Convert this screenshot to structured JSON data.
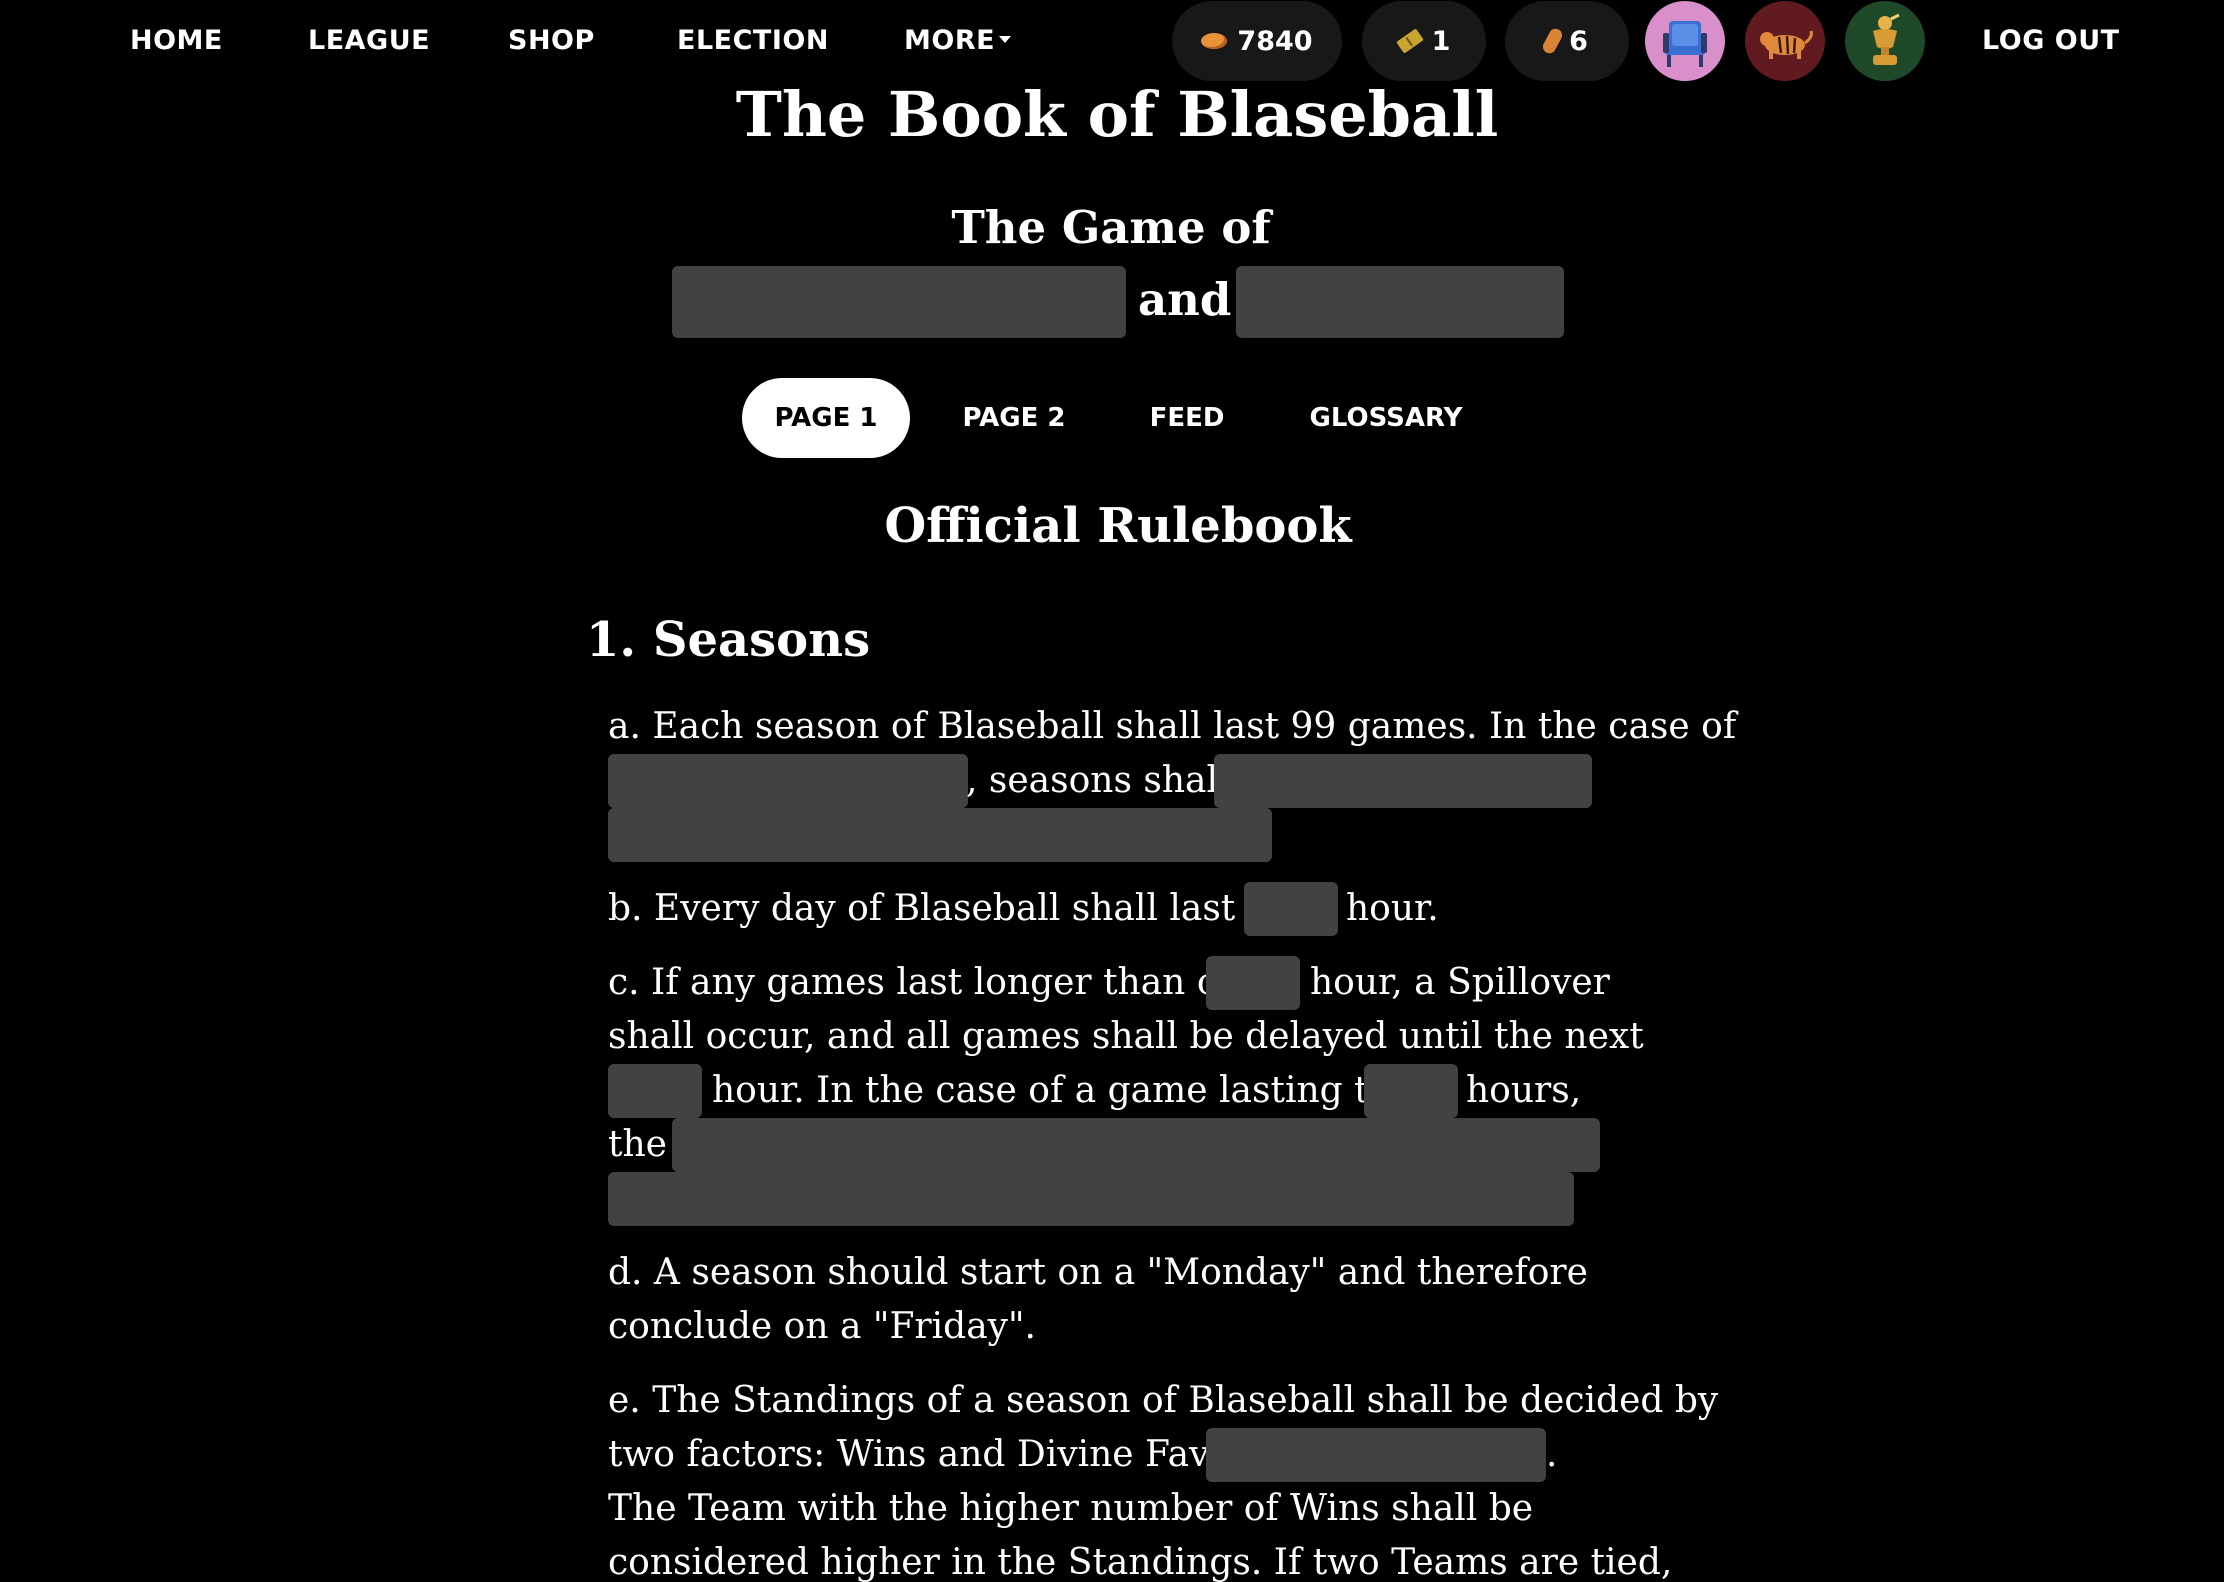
{
  "nav": {
    "home": "HOME",
    "league": "LEAGUE",
    "shop": "SHOP",
    "election": "ELECTION",
    "more": "MORE",
    "logout": "LOG OUT",
    "coins": "7840",
    "votes": "1",
    "peanuts": "6",
    "coin_icon": "coin-icon",
    "votes_icon": "ticket-icon",
    "peanut_icon": "peanut-icon",
    "circle_icons": [
      "stadium-seat-icon",
      "tiger-icon",
      "trophy-icon"
    ]
  },
  "header": {
    "title": "The Book of Blaseball",
    "game_of": "The Game of",
    "and": "and"
  },
  "tabs": [
    "PAGE 1",
    "PAGE 2",
    "FEED",
    "GLOSSARY"
  ],
  "rulebook": {
    "title": "Official Rulebook",
    "section": "1. Seasons",
    "lines": {
      "a1": "a. Each season of Blaseball shall last 99 games. In the case of",
      "a2": ", seasons shall",
      "b1": "b. Every day of Blaseball shall last one",
      "b2": "hour.",
      "c1": "c. If any games last longer than one",
      "c2": "hour, a Spillover",
      "c3": "shall occur, and all games shall be delayed until the next",
      "c4": "hour. In the case of a game lasting two",
      "c5": "hours,",
      "c6": "the",
      "d1": "d. A season should start on a \"Monday\" and therefore",
      "d2": "conclude on a \"Friday\".",
      "e1": "e. The Standings of a season of Blaseball shall be decided by",
      "e2": "two factors: Wins and Divine Favor.",
      "e3": ".",
      "e4": "The Team with the higher number of Wins shall be",
      "e5": "considered higher in the Standings. If two Teams are tied,"
    }
  }
}
